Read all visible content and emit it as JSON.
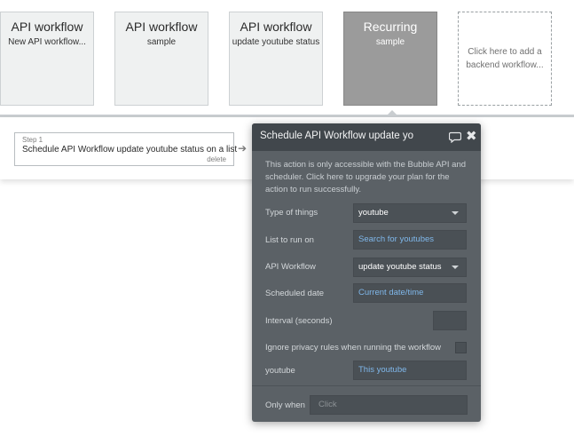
{
  "cards": [
    {
      "title": "API workflow",
      "subtitle": "New API workflow..."
    },
    {
      "title": "API workflow",
      "subtitle": "sample"
    },
    {
      "title": "API workflow",
      "subtitle": "update youtube status"
    },
    {
      "title": "Recurring",
      "subtitle": "sample"
    }
  ],
  "add_card": {
    "text": "Click here to add a backend workflow..."
  },
  "step": {
    "label": "Step 1",
    "text": "Schedule API Workflow update youtube status on a list",
    "delete_label": "delete"
  },
  "panel": {
    "title": "Schedule API Workflow update yo",
    "warning": "This action is only accessible with the Bubble API and scheduler. Click here to upgrade your plan for the action to run successfully.",
    "rows": {
      "type_of_things": {
        "label": "Type of things",
        "value": "youtube"
      },
      "list_to_run_on": {
        "label": "List to run on",
        "value": "Search for youtubes"
      },
      "api_workflow": {
        "label": "API Workflow",
        "value": "update youtube status"
      },
      "scheduled_date": {
        "label": "Scheduled date",
        "value": "Current date/time"
      },
      "interval": {
        "label": "Interval (seconds)",
        "value": ""
      },
      "ignore_privacy": {
        "label": "Ignore privacy rules when running the workflow"
      },
      "youtube": {
        "label": "youtube",
        "value": "This youtube"
      },
      "only_when": {
        "label": "Only when",
        "placeholder": "Click"
      }
    }
  },
  "colors": {
    "panel_bg": "#5b6166",
    "panel_header": "#41474c",
    "dynamic_text": "#7fb7ea",
    "active_card": "#9b9b9b"
  },
  "icons": {
    "comment": "comment-icon",
    "close": "close-icon",
    "arrow": "arrow-right-icon",
    "dropdown": "chevron-down-icon"
  }
}
